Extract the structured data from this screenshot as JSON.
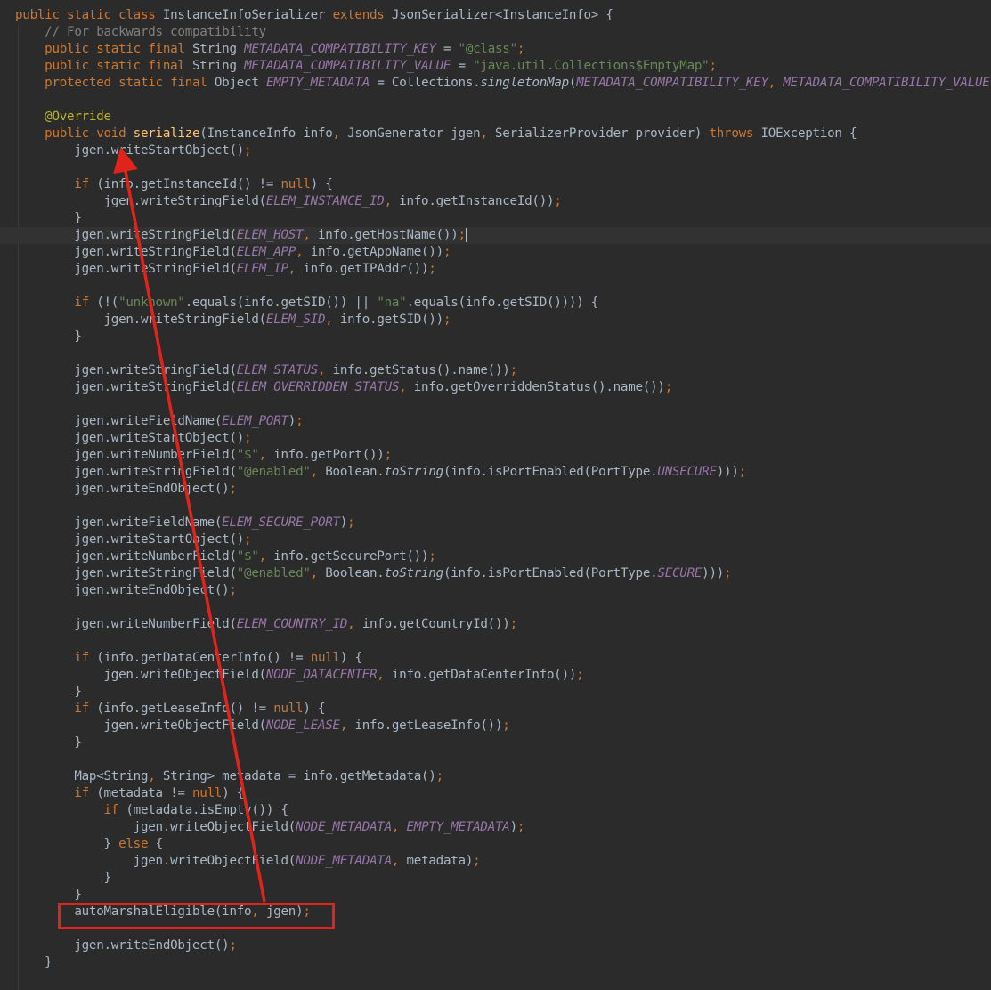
{
  "editor": {
    "lines": [
      [
        {
          "t": "public static class ",
          "c": "kw"
        },
        {
          "t": "InstanceInfoSerializer "
        },
        {
          "t": "extends ",
          "c": "kw"
        },
        {
          "t": "JsonSerializer<InstanceInfo> {"
        }
      ],
      [
        {
          "t": "    "
        },
        {
          "t": "// For backwards compatibility",
          "c": "cm"
        }
      ],
      [
        {
          "t": "    "
        },
        {
          "t": "public static final ",
          "c": "kw"
        },
        {
          "t": "String "
        },
        {
          "t": "METADATA_COMPATIBILITY_KEY",
          "c": "fd"
        },
        {
          "t": " = "
        },
        {
          "t": "\"@class\"",
          "c": "st"
        },
        {
          "t": ";",
          "c": "kw"
        }
      ],
      [
        {
          "t": "    "
        },
        {
          "t": "public static final ",
          "c": "kw"
        },
        {
          "t": "String "
        },
        {
          "t": "METADATA_COMPATIBILITY_VALUE",
          "c": "fd"
        },
        {
          "t": " = "
        },
        {
          "t": "\"java.util.Collections$EmptyMap\"",
          "c": "st"
        },
        {
          "t": ";",
          "c": "kw"
        }
      ],
      [
        {
          "t": "    "
        },
        {
          "t": "protected static final ",
          "c": "kw"
        },
        {
          "t": "Object "
        },
        {
          "t": "EMPTY_METADATA",
          "c": "fd"
        },
        {
          "t": " = Collections."
        },
        {
          "t": "singletonMap",
          "c": "sm"
        },
        {
          "t": "("
        },
        {
          "t": "METADATA_COMPATIBILITY_KEY",
          "c": "fd"
        },
        {
          "t": ", ",
          "c": "kw"
        },
        {
          "t": "METADATA_COMPATIBILITY_VALUE",
          "c": "fd"
        },
        {
          "t": ")"
        },
        {
          "t": ";",
          "c": "kw"
        }
      ],
      [],
      [
        {
          "t": "    "
        },
        {
          "t": "@Override",
          "c": "an"
        }
      ],
      [
        {
          "t": "    "
        },
        {
          "t": "public void ",
          "c": "kw"
        },
        {
          "t": "serialize",
          "c": "mt"
        },
        {
          "t": "(InstanceInfo info"
        },
        {
          "t": ", ",
          "c": "kw"
        },
        {
          "t": "JsonGenerator jgen"
        },
        {
          "t": ", ",
          "c": "kw"
        },
        {
          "t": "SerializerProvider provider) "
        },
        {
          "t": "throws ",
          "c": "kw"
        },
        {
          "t": "IOException {"
        }
      ],
      [
        {
          "t": "        jgen.writeStartObject()"
        },
        {
          "t": ";",
          "c": "kw"
        }
      ],
      [],
      [
        {
          "t": "        "
        },
        {
          "t": "if ",
          "c": "kw"
        },
        {
          "t": "(info.getInstanceId() != "
        },
        {
          "t": "null",
          "c": "kw"
        },
        {
          "t": ") {"
        }
      ],
      [
        {
          "t": "            jgen.writeStringField("
        },
        {
          "t": "ELEM_INSTANCE_ID",
          "c": "fd"
        },
        {
          "t": ", ",
          "c": "kw"
        },
        {
          "t": "info.getInstanceId())"
        },
        {
          "t": ";",
          "c": "kw"
        }
      ],
      [
        {
          "t": "        }"
        }
      ],
      [
        {
          "t": "        jgen.writeStringField("
        },
        {
          "t": "ELEM_HOST",
          "c": "fd"
        },
        {
          "t": ", ",
          "c": "kw"
        },
        {
          "t": "info.getHostName())"
        },
        {
          "t": ";",
          "c": "kw"
        }
      ],
      [
        {
          "t": "        jgen.writeStringField("
        },
        {
          "t": "ELEM_APP",
          "c": "fd"
        },
        {
          "t": ", ",
          "c": "kw"
        },
        {
          "t": "info.getAppName())"
        },
        {
          "t": ";",
          "c": "kw"
        }
      ],
      [
        {
          "t": "        jgen.writeStringField("
        },
        {
          "t": "ELEM_IP",
          "c": "fd"
        },
        {
          "t": ", ",
          "c": "kw"
        },
        {
          "t": "info.getIPAddr())"
        },
        {
          "t": ";",
          "c": "kw"
        }
      ],
      [],
      [
        {
          "t": "        "
        },
        {
          "t": "if ",
          "c": "kw"
        },
        {
          "t": "(!("
        },
        {
          "t": "\"unknown\"",
          "c": "st"
        },
        {
          "t": ".equals(info.getSID()) || "
        },
        {
          "t": "\"na\"",
          "c": "st"
        },
        {
          "t": ".equals(info.getSID()))) {"
        }
      ],
      [
        {
          "t": "            jgen.writeStringField("
        },
        {
          "t": "ELEM_SID",
          "c": "fd"
        },
        {
          "t": ", ",
          "c": "kw"
        },
        {
          "t": "info.getSID())"
        },
        {
          "t": ";",
          "c": "kw"
        }
      ],
      [
        {
          "t": "        }"
        }
      ],
      [],
      [
        {
          "t": "        jgen.writeStringField("
        },
        {
          "t": "ELEM_STATUS",
          "c": "fd"
        },
        {
          "t": ", ",
          "c": "kw"
        },
        {
          "t": "info.getStatus().name())"
        },
        {
          "t": ";",
          "c": "kw"
        }
      ],
      [
        {
          "t": "        jgen.writeStringField("
        },
        {
          "t": "ELEM_OVERRIDDEN_STATUS",
          "c": "fd"
        },
        {
          "t": ", ",
          "c": "kw"
        },
        {
          "t": "info.getOverriddenStatus().name())"
        },
        {
          "t": ";",
          "c": "kw"
        }
      ],
      [],
      [
        {
          "t": "        jgen.writeFieldName("
        },
        {
          "t": "ELEM_PORT",
          "c": "fd"
        },
        {
          "t": ")"
        },
        {
          "t": ";",
          "c": "kw"
        }
      ],
      [
        {
          "t": "        jgen.writeStartObject()"
        },
        {
          "t": ";",
          "c": "kw"
        }
      ],
      [
        {
          "t": "        jgen.writeNumberField("
        },
        {
          "t": "\"$\"",
          "c": "st"
        },
        {
          "t": ", ",
          "c": "kw"
        },
        {
          "t": "info.getPort())"
        },
        {
          "t": ";",
          "c": "kw"
        }
      ],
      [
        {
          "t": "        jgen.writeStringField("
        },
        {
          "t": "\"@enabled\"",
          "c": "st"
        },
        {
          "t": ", ",
          "c": "kw"
        },
        {
          "t": "Boolean."
        },
        {
          "t": "toString",
          "c": "sm"
        },
        {
          "t": "(info.isPortEnabled(PortType."
        },
        {
          "t": "UNSECURE",
          "c": "fd"
        },
        {
          "t": ")))"
        },
        {
          "t": ";",
          "c": "kw"
        }
      ],
      [
        {
          "t": "        jgen.writeEndObject()"
        },
        {
          "t": ";",
          "c": "kw"
        }
      ],
      [],
      [
        {
          "t": "        jgen.writeFieldName("
        },
        {
          "t": "ELEM_SECURE_PORT",
          "c": "fd"
        },
        {
          "t": ")"
        },
        {
          "t": ";",
          "c": "kw"
        }
      ],
      [
        {
          "t": "        jgen.writeStartObject()"
        },
        {
          "t": ";",
          "c": "kw"
        }
      ],
      [
        {
          "t": "        jgen.writeNumberField("
        },
        {
          "t": "\"$\"",
          "c": "st"
        },
        {
          "t": ", ",
          "c": "kw"
        },
        {
          "t": "info.getSecurePort())"
        },
        {
          "t": ";",
          "c": "kw"
        }
      ],
      [
        {
          "t": "        jgen.writeStringField("
        },
        {
          "t": "\"@enabled\"",
          "c": "st"
        },
        {
          "t": ", ",
          "c": "kw"
        },
        {
          "t": "Boolean."
        },
        {
          "t": "toString",
          "c": "sm"
        },
        {
          "t": "(info.isPortEnabled(PortType."
        },
        {
          "t": "SECURE",
          "c": "fd"
        },
        {
          "t": ")))"
        },
        {
          "t": ";",
          "c": "kw"
        }
      ],
      [
        {
          "t": "        jgen.writeEndObject()"
        },
        {
          "t": ";",
          "c": "kw"
        }
      ],
      [],
      [
        {
          "t": "        jgen.writeNumberField("
        },
        {
          "t": "ELEM_COUNTRY_ID",
          "c": "fd"
        },
        {
          "t": ", ",
          "c": "kw"
        },
        {
          "t": "info.getCountryId())"
        },
        {
          "t": ";",
          "c": "kw"
        }
      ],
      [],
      [
        {
          "t": "        "
        },
        {
          "t": "if ",
          "c": "kw"
        },
        {
          "t": "(info.getDataCenterInfo() != "
        },
        {
          "t": "null",
          "c": "kw"
        },
        {
          "t": ") {"
        }
      ],
      [
        {
          "t": "            jgen.writeObjectField("
        },
        {
          "t": "NODE_DATACENTER",
          "c": "fd"
        },
        {
          "t": ", ",
          "c": "kw"
        },
        {
          "t": "info.getDataCenterInfo())"
        },
        {
          "t": ";",
          "c": "kw"
        }
      ],
      [
        {
          "t": "        }"
        }
      ],
      [
        {
          "t": "        "
        },
        {
          "t": "if ",
          "c": "kw"
        },
        {
          "t": "(info.getLeaseInfo() != "
        },
        {
          "t": "null",
          "c": "kw"
        },
        {
          "t": ") {"
        }
      ],
      [
        {
          "t": "            jgen.writeObjectField("
        },
        {
          "t": "NODE_LEASE",
          "c": "fd"
        },
        {
          "t": ", ",
          "c": "kw"
        },
        {
          "t": "info.getLeaseInfo())"
        },
        {
          "t": ";",
          "c": "kw"
        }
      ],
      [
        {
          "t": "        }"
        }
      ],
      [],
      [
        {
          "t": "        Map<String"
        },
        {
          "t": ", ",
          "c": "kw"
        },
        {
          "t": "String> metadata = info.getMetadata()"
        },
        {
          "t": ";",
          "c": "kw"
        }
      ],
      [
        {
          "t": "        "
        },
        {
          "t": "if ",
          "c": "kw"
        },
        {
          "t": "(metadata != "
        },
        {
          "t": "null",
          "c": "kw"
        },
        {
          "t": ") {"
        }
      ],
      [
        {
          "t": "            "
        },
        {
          "t": "if ",
          "c": "kw"
        },
        {
          "t": "(metadata.isEmpty()) {"
        }
      ],
      [
        {
          "t": "                jgen.writeObjectField("
        },
        {
          "t": "NODE_METADATA",
          "c": "fd"
        },
        {
          "t": ", ",
          "c": "kw"
        },
        {
          "t": "EMPTY_METADATA",
          "c": "fd"
        },
        {
          "t": ")"
        },
        {
          "t": ";",
          "c": "kw"
        }
      ],
      [
        {
          "t": "            } "
        },
        {
          "t": "else ",
          "c": "kw"
        },
        {
          "t": "{"
        }
      ],
      [
        {
          "t": "                jgen.writeObjectField("
        },
        {
          "t": "NODE_METADATA",
          "c": "fd"
        },
        {
          "t": ", ",
          "c": "kw"
        },
        {
          "t": "metadata)"
        },
        {
          "t": ";",
          "c": "kw"
        }
      ],
      [
        {
          "t": "            }"
        }
      ],
      [
        {
          "t": "        }"
        }
      ],
      [
        {
          "t": "        autoMarshalEligible(info"
        },
        {
          "t": ", ",
          "c": "kw"
        },
        {
          "t": "jgen)"
        },
        {
          "t": ";",
          "c": "kw"
        }
      ],
      [],
      [
        {
          "t": "        jgen.writeEndObject()"
        },
        {
          "t": ";",
          "c": "kw"
        }
      ],
      [
        {
          "t": "    }"
        }
      ]
    ],
    "current_line": 13
  },
  "colors": {
    "background": "#2b2b2b",
    "annotation_red": "#e0241c"
  }
}
